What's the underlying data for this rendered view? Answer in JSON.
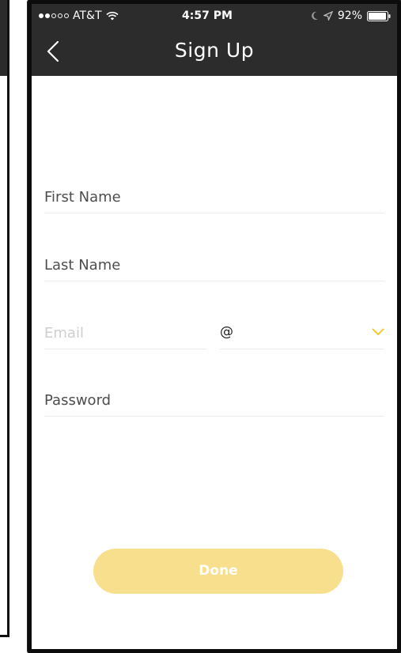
{
  "status_bar": {
    "carrier": "AT&T",
    "time": "4:57 PM",
    "battery": "92%",
    "signal_bars_on": 2,
    "signal_bars_total": 5
  },
  "nav": {
    "title": "Sign Up",
    "back_icon": "chevron-left-icon"
  },
  "form": {
    "first_name": {
      "placeholder": "First Name",
      "value": ""
    },
    "last_name": {
      "placeholder": "Last Name",
      "value": ""
    },
    "email": {
      "placeholder": "Email",
      "value": ""
    },
    "email_domain": {
      "prefix": "@",
      "value": "",
      "icon": "chevron-down-icon"
    },
    "password": {
      "placeholder": "Password",
      "value": ""
    }
  },
  "actions": {
    "done_label": "Done"
  },
  "colors": {
    "header_bg": "#2c2c2c",
    "accent": "#f5c518",
    "button_disabled": "#f8df8e",
    "divider": "#ececec"
  }
}
